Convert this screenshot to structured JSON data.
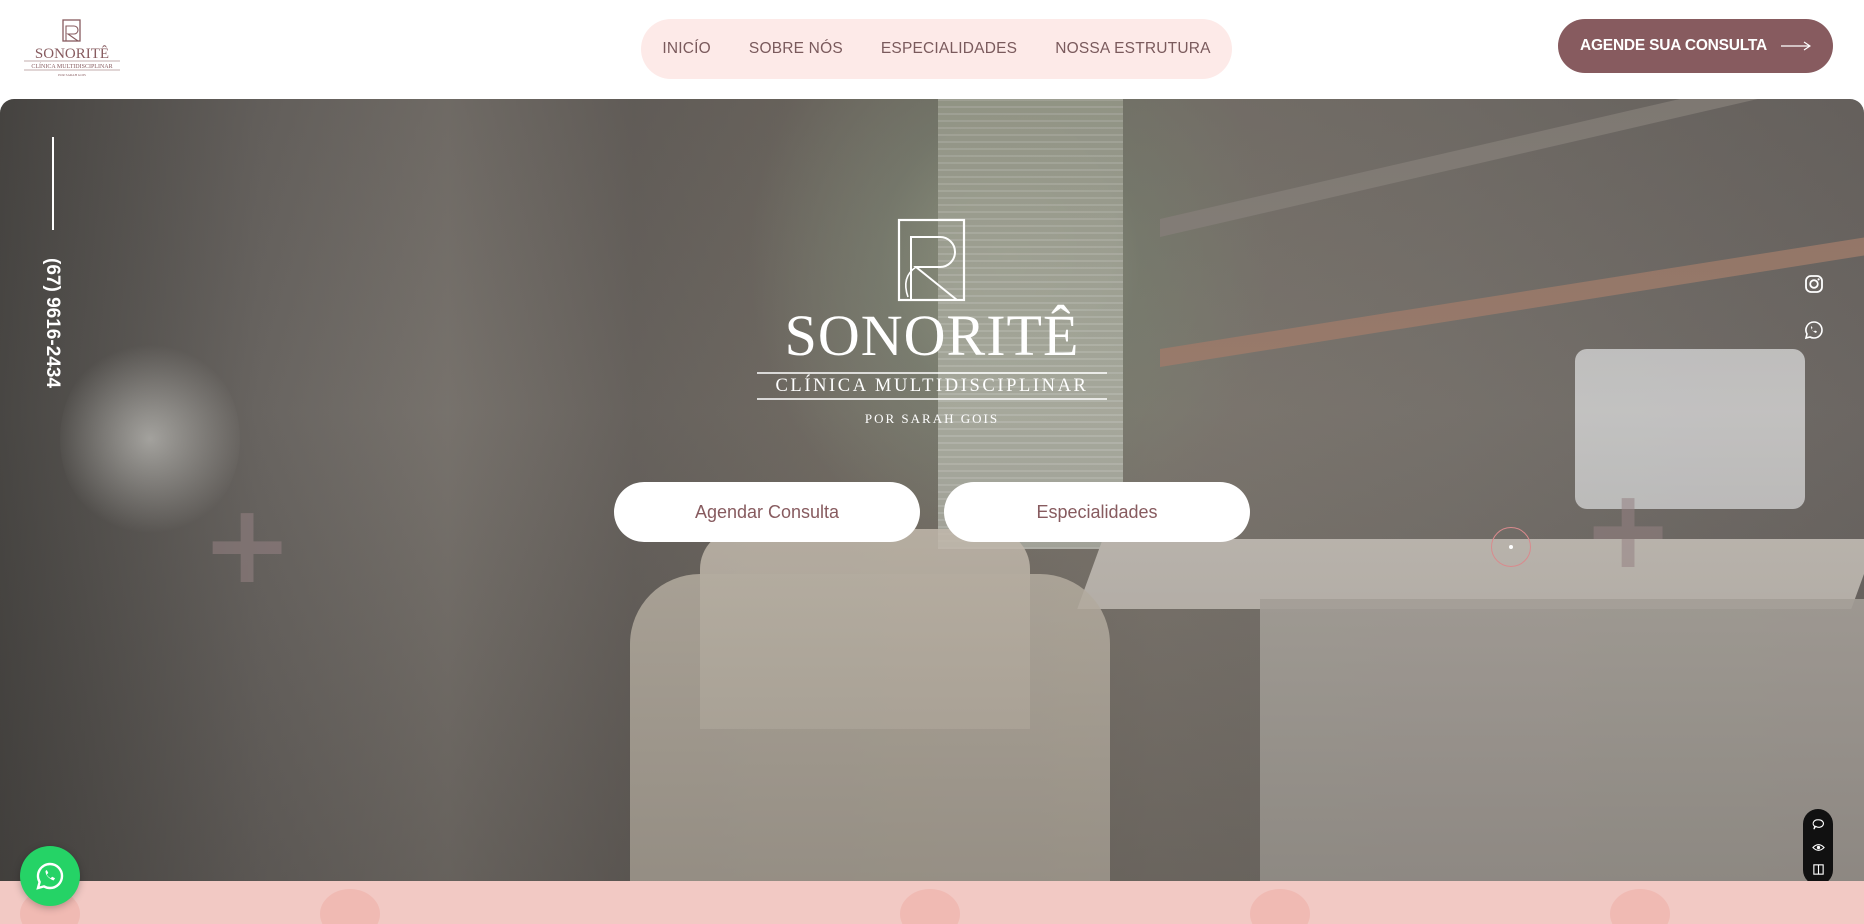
{
  "brand": {
    "name": "SONORITÊ",
    "tagline": "CLÍNICA MULTIDISCIPLINAR",
    "byline": "POR SARAH GOIS"
  },
  "nav": {
    "items": [
      {
        "label": "INICÍO"
      },
      {
        "label": "SOBRE NÓS"
      },
      {
        "label": "ESPECIALIDADES"
      },
      {
        "label": "NOSSA ESTRUTURA"
      }
    ]
  },
  "header": {
    "cta_label": "AGENDE SUA CONSULTA"
  },
  "hero": {
    "primary_button": "Agendar Consulta",
    "secondary_button": "Especialidades",
    "phone": "(67) 9616-2434",
    "plus_glyph": "+"
  },
  "colors": {
    "accent": "#875b5f",
    "nav_bg": "#fdeae8",
    "whatsapp": "#25d366",
    "strip": "#f2c9c4"
  },
  "icons": {
    "social": [
      "instagram-icon",
      "whatsapp-icon"
    ],
    "accessibility": [
      "chat-icon",
      "eye-icon",
      "book-icon"
    ],
    "floating": "whatsapp-icon"
  }
}
